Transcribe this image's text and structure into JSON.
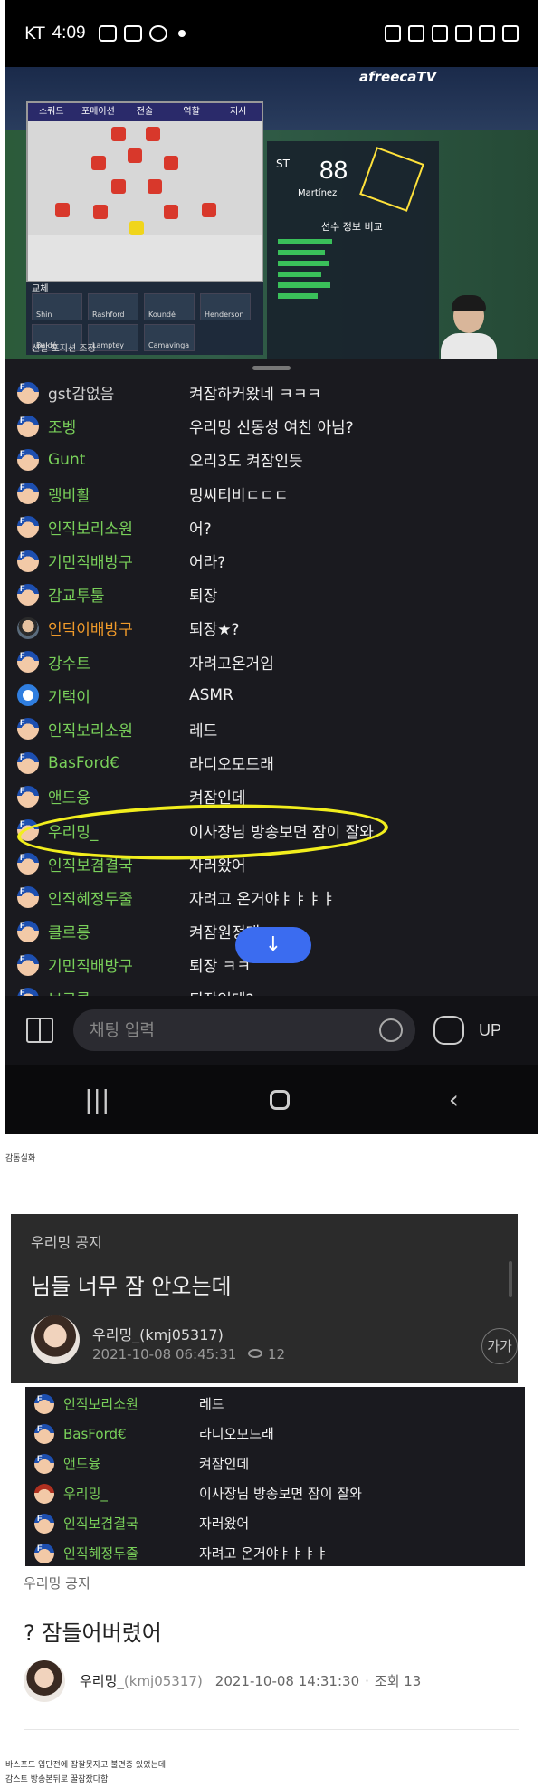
{
  "status_bar": {
    "carrier": "KT",
    "time": "4:09"
  },
  "stream": {
    "brand": "afreecaTV",
    "tabs": [
      "스쿼드",
      "포메이션",
      "전술",
      "역할",
      "지시"
    ],
    "player": {
      "position": "ST",
      "rating": "88",
      "name": "Martínez"
    },
    "compare_title": "선수 정보 비교",
    "bench_label": "교체",
    "bench": [
      "Shin",
      "Rashford",
      "Koundé",
      "Henderson",
      "Baldé",
      "Lamptey",
      "Camavinga"
    ],
    "footer_text": "선발 포지션 조정"
  },
  "chat": {
    "messages": [
      {
        "nick": "gst감없음",
        "text": "켜잠하커왔네 ㅋㅋㅋ",
        "avatar": "fan",
        "color": "gray"
      },
      {
        "nick": "조벵",
        "text": "우리밍 신동성 여친 아님?",
        "avatar": "fan",
        "color": "green"
      },
      {
        "nick": "Gunt",
        "text": "오리3도 켜잠인듯",
        "avatar": "fan",
        "color": "green"
      },
      {
        "nick": "랭비활",
        "text": "밍씨티비ㄷㄷㄷ",
        "avatar": "fan",
        "color": "green"
      },
      {
        "nick": "인직보리소원",
        "text": "어?",
        "avatar": "fan",
        "color": "green"
      },
      {
        "nick": "기민직배방구",
        "text": "어라?",
        "avatar": "fan",
        "color": "green"
      },
      {
        "nick": "감교투툴",
        "text": "퇴장",
        "avatar": "fan",
        "color": "green"
      },
      {
        "nick": "인딕이배방구",
        "text": "퇴장★?",
        "avatar": "photo",
        "color": "orange"
      },
      {
        "nick": "강수트",
        "text": "자려고온거임",
        "avatar": "fan",
        "color": "green"
      },
      {
        "nick": "기택이",
        "text": "ASMR",
        "avatar": "bot",
        "color": "green"
      },
      {
        "nick": "인직보리소원",
        "text": "레드",
        "avatar": "fan",
        "color": "green"
      },
      {
        "nick": "BasFord€",
        "text": "라디오모드래",
        "avatar": "fan",
        "color": "green"
      },
      {
        "nick": "앤드융",
        "text": "켜잠인데",
        "avatar": "fan",
        "color": "green"
      },
      {
        "nick": "우리밍_",
        "text": "이사장님 방송보면 잠이 잘와",
        "avatar": "fan",
        "color": "green"
      },
      {
        "nick": "인직보겸결국",
        "text": "자러왔어",
        "avatar": "fan",
        "color": "green"
      },
      {
        "nick": "인직혜정두줄",
        "text": "자려고 온거야ㅑㅑㅑㅑ",
        "avatar": "fan",
        "color": "green"
      },
      {
        "nick": "클르릉",
        "text": "켜잠원정대",
        "avatar": "fan",
        "color": "green"
      },
      {
        "nick": "기민직배방구",
        "text": "퇴장 ㅋㅋ",
        "avatar": "fan",
        "color": "green"
      },
      {
        "nick": "브로콜",
        "text": "퇴장인데?",
        "avatar": "fan",
        "color": "green"
      }
    ],
    "input_placeholder": "채팅 입력",
    "up_label": "UP",
    "scroll_down_icon": "arrow-down-icon"
  },
  "caption1": "감동실화",
  "notice1": {
    "board": "우리밍 공지",
    "title": "님들 너무 잠 안오는데",
    "author": "우리밍_(kmj05317)",
    "date": "2021-10-08 06:45:31",
    "views": "12",
    "font_button": "가가"
  },
  "crop_chat": [
    {
      "nick": "인직보리소원",
      "text": "레드",
      "avatar": "fan"
    },
    {
      "nick": "BasFord€",
      "text": "라디오모드래",
      "avatar": "fan"
    },
    {
      "nick": "앤드융",
      "text": "켜잠인데",
      "avatar": "fan"
    },
    {
      "nick": "우리밍_",
      "text": "이사장님 방송보면 잠이 잘와",
      "avatar": "fanred"
    },
    {
      "nick": "인직보겸결국",
      "text": "자러왔어",
      "avatar": "fan"
    },
    {
      "nick": "인직혜정두줄",
      "text": "자려고 온거야ㅑㅑㅑㅑ",
      "avatar": "fan"
    }
  ],
  "notice2": {
    "board": "우리밍 공지",
    "title": "? 잠들어버렸어",
    "author": "우리밍_",
    "author_id": "(kmj05317)",
    "date": "2021-10-08 14:31:30",
    "views_label": "조회 13"
  },
  "caption2_line1": "바스포드 입단전에 잠잘못자고 불면증 있었는데",
  "caption2_line2": "감스트 방송본뒤로 꿀잠잤다함",
  "colors": {
    "chat_bg": "#1a1a1f",
    "nick_green": "#79d05a",
    "highlight": "#f2ee1d",
    "scroll_button": "#3b6cf0"
  }
}
